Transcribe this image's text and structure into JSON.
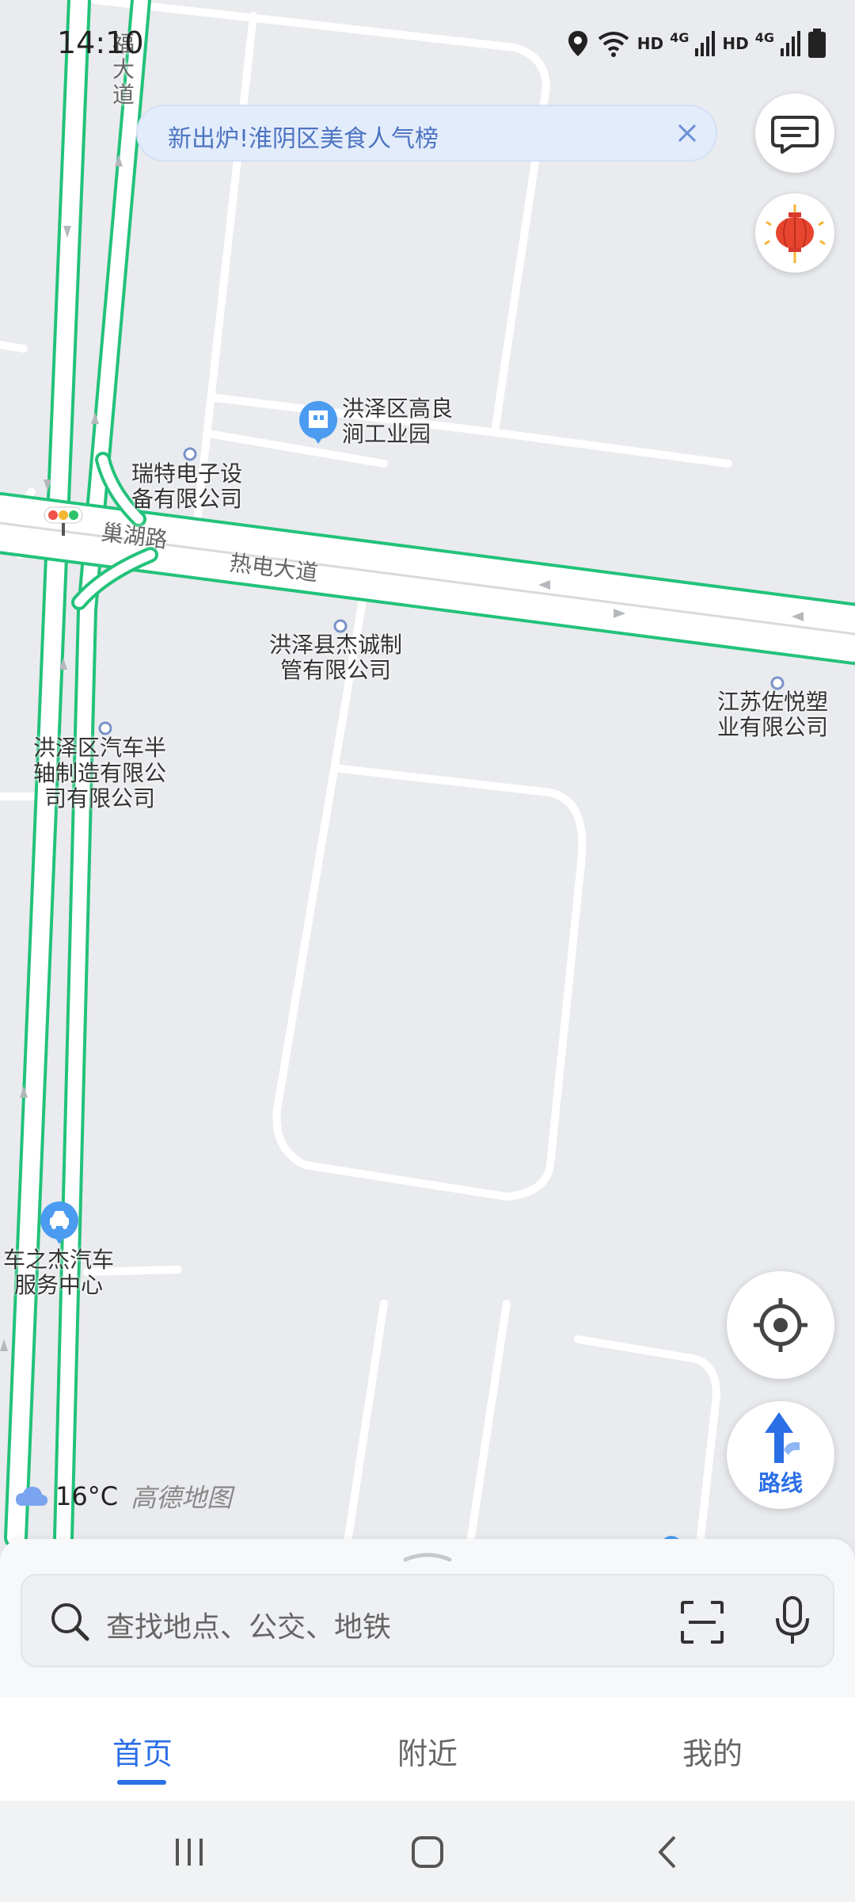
{
  "status_bar": {
    "time": "14:10",
    "hd1": "HD",
    "hd2": "HD",
    "net1": "4G",
    "net2": "4G"
  },
  "banner": {
    "text": "新出炉!淮阴区美食人气榜"
  },
  "map": {
    "pois": [
      {
        "name": "洪泽区高良\n涧工业园"
      },
      {
        "name": "瑞特电子设\n备有限公司"
      },
      {
        "name": "洪泽县杰诚制\n管有限公司"
      },
      {
        "name": "江苏佐悦塑\n业有限公司"
      },
      {
        "name": "洪泽区汽车半\n轴制造有限公\n司有限公司"
      },
      {
        "name": "车之杰汽车\n服务中心"
      }
    ],
    "roads": {
      "r1": "巢湖路",
      "r2": "热电大道",
      "r3": "福\n大\n道"
    }
  },
  "weather": {
    "temperature": "16°C",
    "brand": "高德地图"
  },
  "route_button": {
    "label": "路线"
  },
  "search": {
    "placeholder": "查找地点、公交、地铁"
  },
  "tabs": [
    {
      "label": "首页",
      "active": true
    },
    {
      "label": "附近",
      "active": false
    },
    {
      "label": "我的",
      "active": false
    }
  ],
  "colors": {
    "accent": "#2b6fe6",
    "traffic_green": "#22c27a",
    "map_bg": "#e9ebee"
  }
}
